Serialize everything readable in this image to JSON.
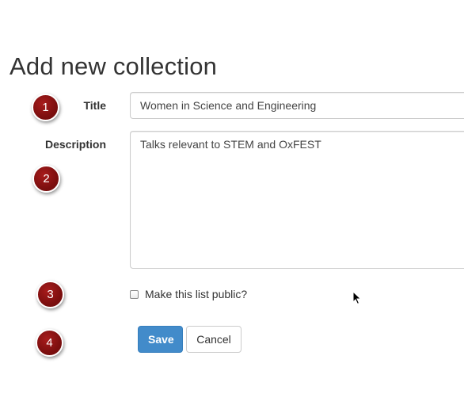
{
  "page": {
    "title": "Add new collection"
  },
  "form": {
    "title_label": "Title",
    "title_value": "Women in Science and Engineering",
    "description_label": "Description",
    "description_value": "Talks relevant to STEM and OxFEST",
    "public_checkbox_label": "Make this list public?",
    "public_checked": false,
    "save_label": "Save",
    "cancel_label": "Cancel"
  },
  "step_markers": [
    "1",
    "2",
    "3",
    "4"
  ],
  "colors": {
    "primary_button": "#428bca",
    "marker": "#7d0f0f",
    "input_border": "#cccccc"
  },
  "icons": {
    "cursor": "mouse-pointer-icon"
  }
}
